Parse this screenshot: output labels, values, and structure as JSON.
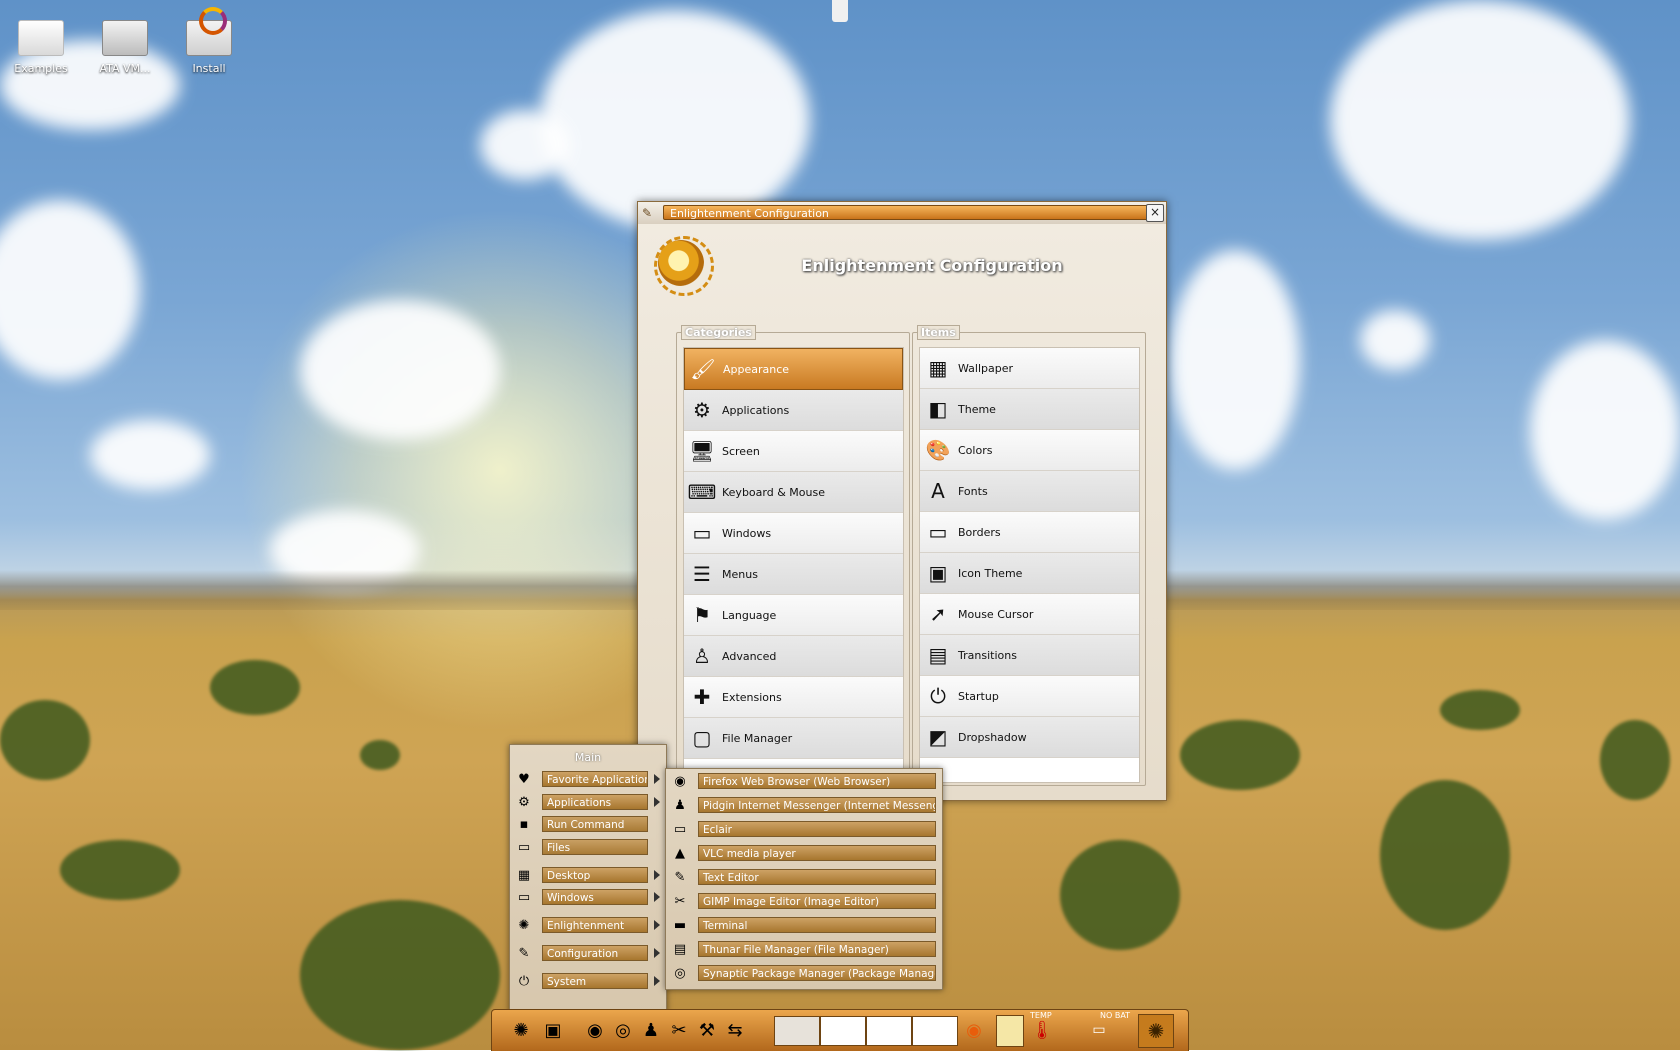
{
  "desktop": {
    "icons": [
      {
        "label": "Examples",
        "icon": "folder-icon"
      },
      {
        "label": "ATA VM...",
        "icon": "drive-icon"
      },
      {
        "label": "Install",
        "icon": "install-icon"
      }
    ]
  },
  "window": {
    "title": "Enlightenment Configuration",
    "heading": "Enlightenment Configuration",
    "close_glyph": "×",
    "categories_label": "Categories",
    "items_label": "Items",
    "categories": [
      {
        "label": "Appearance",
        "icon": "appearance-icon",
        "glyph": "🖌",
        "selected": true
      },
      {
        "label": "Applications",
        "icon": "applications-icon",
        "glyph": "⚙"
      },
      {
        "label": "Screen",
        "icon": "screen-icon",
        "glyph": "🖥"
      },
      {
        "label": "Keyboard & Mouse",
        "icon": "keyboard-icon",
        "glyph": "⌨"
      },
      {
        "label": "Windows",
        "icon": "windows-icon",
        "glyph": "▭"
      },
      {
        "label": "Menus",
        "icon": "menus-icon",
        "glyph": "☰"
      },
      {
        "label": "Language",
        "icon": "flag-icon",
        "glyph": "⚑"
      },
      {
        "label": "Advanced",
        "icon": "advanced-icon",
        "glyph": "♙"
      },
      {
        "label": "Extensions",
        "icon": "puzzle-icon",
        "glyph": "✚"
      },
      {
        "label": "File Manager",
        "icon": "file-manager-icon",
        "glyph": "▢"
      }
    ],
    "items": [
      {
        "label": "Wallpaper",
        "icon": "wallpaper-icon",
        "glyph": "▦"
      },
      {
        "label": "Theme",
        "icon": "theme-icon",
        "glyph": "◧"
      },
      {
        "label": "Colors",
        "icon": "palette-icon",
        "glyph": "🎨"
      },
      {
        "label": "Fonts",
        "icon": "fonts-icon",
        "glyph": "A"
      },
      {
        "label": "Borders",
        "icon": "borders-icon",
        "glyph": "▭"
      },
      {
        "label": "Icon Theme",
        "icon": "icon-theme-icon",
        "glyph": "▣"
      },
      {
        "label": "Mouse Cursor",
        "icon": "mouse-cursor-icon",
        "glyph": "➚"
      },
      {
        "label": "Transitions",
        "icon": "transitions-icon",
        "glyph": "▤"
      },
      {
        "label": "Startup",
        "icon": "startup-icon",
        "glyph": "⏻"
      },
      {
        "label": "Dropshadow",
        "icon": "dropshadow-icon",
        "glyph": "◩"
      }
    ]
  },
  "main_menu": {
    "title": "Main",
    "items": [
      {
        "label": "Favorite Applications",
        "icon": "heart-icon",
        "glyph": "♥",
        "submenu": true
      },
      {
        "label": "Applications",
        "icon": "gear-icon",
        "glyph": "⚙",
        "submenu": true
      },
      {
        "label": "Run Command",
        "icon": "terminal-icon",
        "glyph": "▪",
        "submenu": false
      },
      {
        "label": "Files",
        "icon": "folder-icon",
        "glyph": "▭",
        "submenu": false
      },
      {
        "label": "Desktop",
        "icon": "desktop-icon",
        "glyph": "▦",
        "submenu": true
      },
      {
        "label": "Windows",
        "icon": "windows-icon",
        "glyph": "▭",
        "submenu": true
      },
      {
        "label": "Enlightenment",
        "icon": "enlightenment-icon",
        "glyph": "✺",
        "submenu": true
      },
      {
        "label": "Configuration",
        "icon": "configuration-icon",
        "glyph": "✎",
        "submenu": true
      },
      {
        "label": "System",
        "icon": "system-icon",
        "glyph": "⏻",
        "submenu": true
      }
    ]
  },
  "favorites_menu": {
    "items": [
      {
        "label": "Firefox Web Browser (Web Browser)",
        "icon": "firefox-icon",
        "glyph": "◉"
      },
      {
        "label": "Pidgin Internet Messenger (Internet Messenger)",
        "icon": "pidgin-icon",
        "glyph": "♟"
      },
      {
        "label": "Eclair",
        "icon": "window-icon",
        "glyph": "▭"
      },
      {
        "label": "VLC media player",
        "icon": "vlc-icon",
        "glyph": "▲"
      },
      {
        "label": "Text Editor",
        "icon": "text-editor-icon",
        "glyph": "✎"
      },
      {
        "label": "GIMP Image Editor (Image Editor)",
        "icon": "gimp-icon",
        "glyph": "✂"
      },
      {
        "label": "Terminal",
        "icon": "terminal-icon",
        "glyph": "▬"
      },
      {
        "label": "Thunar File Manager (File Manager)",
        "icon": "thunar-icon",
        "glyph": "▤"
      },
      {
        "label": "Synaptic Package Manager (Package Manager)",
        "icon": "synaptic-icon",
        "glyph": "◎"
      }
    ]
  },
  "shelf": {
    "launchers": [
      {
        "icon": "start-icon",
        "glyph": "✺"
      },
      {
        "icon": "monitor-icon",
        "glyph": "▣"
      },
      {
        "icon": "firefox-icon",
        "glyph": "◉"
      },
      {
        "icon": "thunderbird-icon",
        "glyph": "◎"
      },
      {
        "icon": "pidgin-icon",
        "glyph": "♟"
      },
      {
        "icon": "gimp-icon",
        "glyph": "✂"
      },
      {
        "icon": "package-icon",
        "glyph": "⚒"
      },
      {
        "icon": "network-icon",
        "glyph": "⇆"
      }
    ],
    "temp_label": "TEMP",
    "battery_label": "NO BAT",
    "clock_glyph": "✺"
  }
}
